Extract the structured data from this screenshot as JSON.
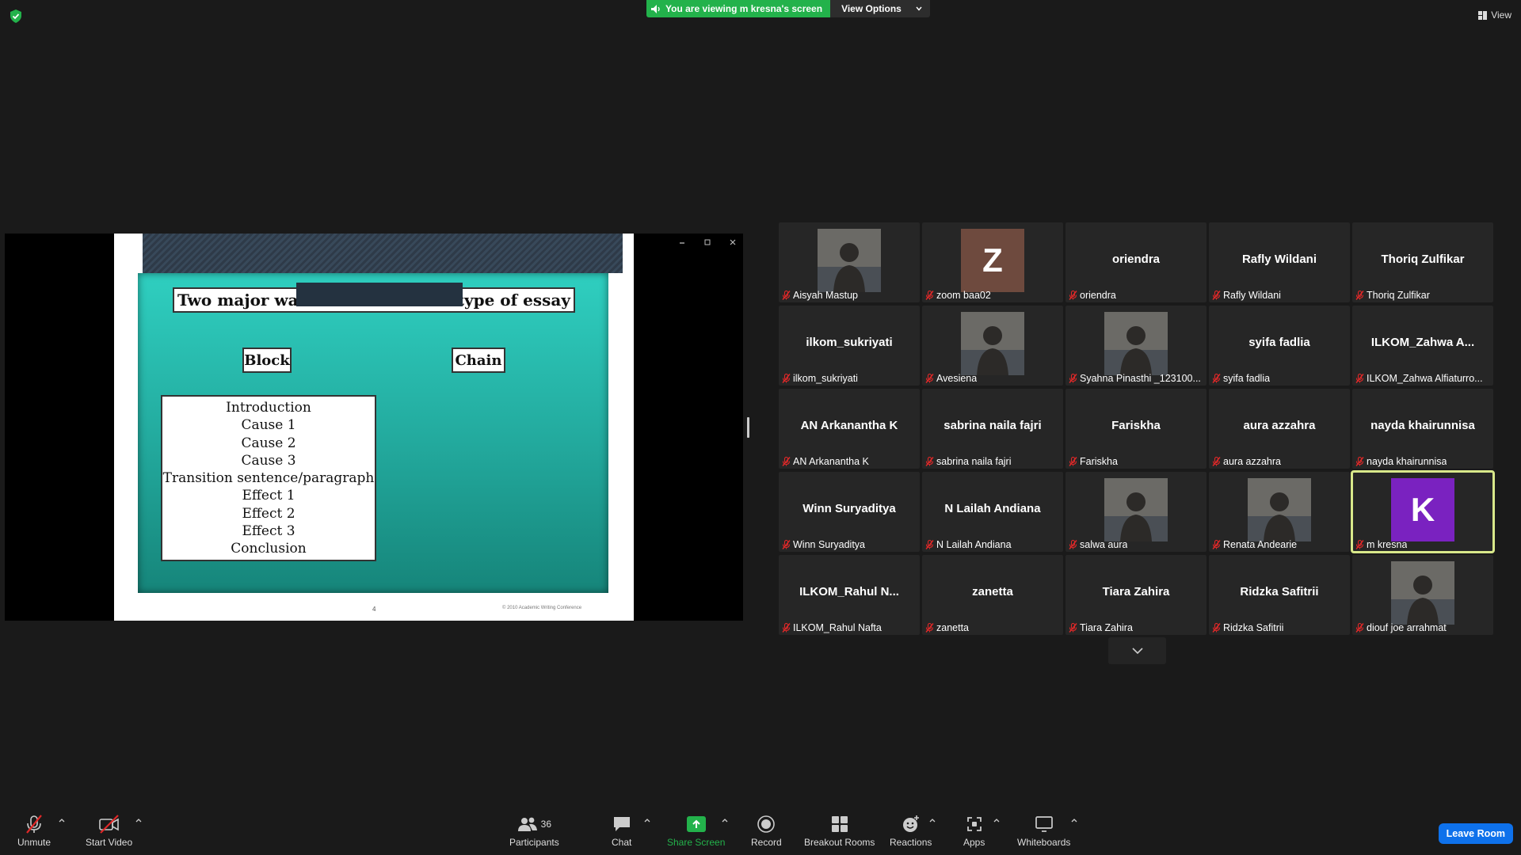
{
  "top_bar": {
    "banner_text": "You are viewing m kresna's screen",
    "view_options_label": "View Options",
    "view_label": "View"
  },
  "shared_slide": {
    "title_left": "Two major wa",
    "title_right": "type of essay",
    "box_block": "Block",
    "box_chain": "Chain",
    "list_items": [
      "Introduction",
      "Cause 1",
      "Cause 2",
      "Cause 3",
      "Transition sentence/paragraph",
      "Effect 1",
      "Effect 2",
      "Effect 3",
      "Conclusion"
    ],
    "page_number": "4",
    "footer": "© 2010 Academic Writing Conference"
  },
  "participants": [
    {
      "display": "photo",
      "label": "Aisyah Mastup"
    },
    {
      "display": "avatar",
      "initial": "Z",
      "avatar_color": "#6e4a3e",
      "label": "zoom baa02"
    },
    {
      "display": "name",
      "name": "oriendra",
      "label": "oriendra"
    },
    {
      "display": "name",
      "name": "Rafly Wildani",
      "label": "Rafly Wildani"
    },
    {
      "display": "name",
      "name": "Thoriq Zulfikar",
      "label": "Thoriq Zulfikar"
    },
    {
      "display": "name",
      "name": "ilkom_sukriyati",
      "label": "ilkom_sukriyati"
    },
    {
      "display": "photo",
      "label": "Avesiena"
    },
    {
      "display": "photo",
      "label": "Syahna Pinasthi _123100..."
    },
    {
      "display": "name",
      "name": "syifa fadlia",
      "label": "syifa fadlia"
    },
    {
      "display": "name",
      "name": "ILKOM_Zahwa A...",
      "label": "ILKOM_Zahwa Alfiaturro..."
    },
    {
      "display": "name",
      "name": "AN Arkanantha K",
      "label": "AN Arkanantha K"
    },
    {
      "display": "name",
      "name": "sabrina naila fajri",
      "label": "sabrina naila fajri"
    },
    {
      "display": "name",
      "name": "Fariskha",
      "label": "Fariskha"
    },
    {
      "display": "name",
      "name": "aura azzahra",
      "label": "aura azzahra"
    },
    {
      "display": "name",
      "name": "nayda khairunnisa",
      "label": "nayda khairunnisa"
    },
    {
      "display": "name",
      "name": "Winn Suryaditya",
      "label": "Winn Suryaditya"
    },
    {
      "display": "name",
      "name": "N Lailah Andiana",
      "label": "N Lailah Andiana"
    },
    {
      "display": "photo",
      "label": "salwa aura"
    },
    {
      "display": "photo",
      "label": "Renata Andearie"
    },
    {
      "display": "avatar",
      "initial": "K",
      "avatar_color": "#7a22c0",
      "label": "m kresna",
      "active": true
    },
    {
      "display": "name",
      "name": "ILKOM_Rahul N...",
      "label": "ILKOM_Rahul Nafta"
    },
    {
      "display": "name",
      "name": "zanetta",
      "label": "zanetta"
    },
    {
      "display": "name",
      "name": "Tiara Zahira",
      "label": "Tiara Zahira"
    },
    {
      "display": "name",
      "name": "Ridzka Safitrii",
      "label": "Ridzka Safitrii"
    },
    {
      "display": "photo",
      "label": "diouf joe arrahmat"
    }
  ],
  "toolbar": {
    "unmute": "Unmute",
    "start_video": "Start Video",
    "participants": "Participants",
    "participants_count": "36",
    "chat": "Chat",
    "share_screen": "Share Screen",
    "record": "Record",
    "breakout_rooms": "Breakout Rooms",
    "reactions": "Reactions",
    "apps": "Apps",
    "whiteboards": "Whiteboards",
    "leave_room": "Leave Room"
  },
  "colors": {
    "accent_green": "#23b24b",
    "active_speaker_outline": "#d8e88a",
    "leave_blue": "#0e71eb",
    "mute_red": "#e02828"
  }
}
